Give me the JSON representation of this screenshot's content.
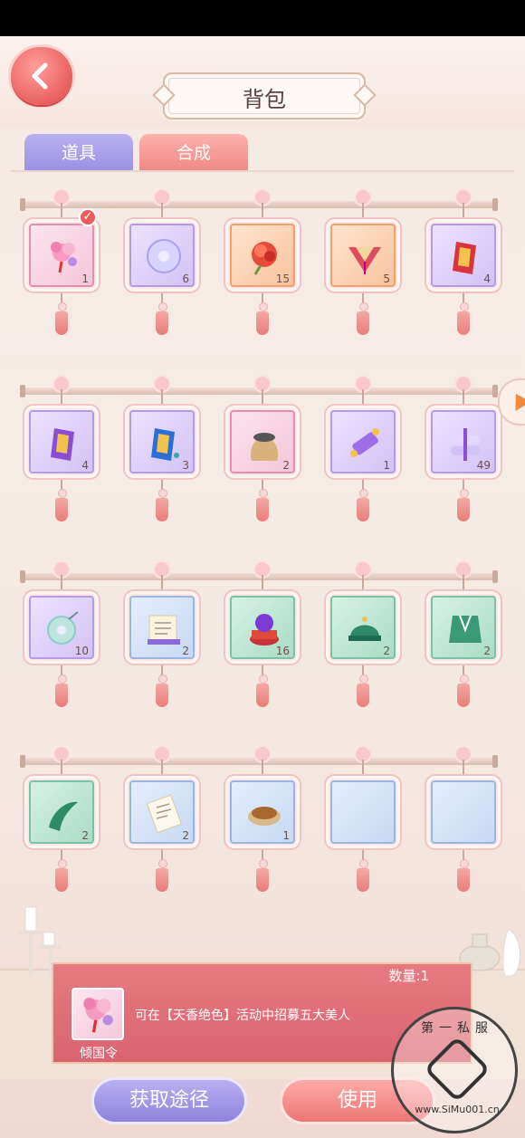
{
  "header": {
    "title": "背包"
  },
  "tabs": {
    "props": "道具",
    "craft": "合成"
  },
  "rows": [
    [
      {
        "name": "pink-flower-token",
        "bg": "pink",
        "count": "1",
        "selected": true
      },
      {
        "name": "jade-disc",
        "bg": "purple",
        "count": "6"
      },
      {
        "name": "peony-flower",
        "bg": "orange",
        "count": "15"
      },
      {
        "name": "red-fan",
        "bg": "orange",
        "count": "5"
      },
      {
        "name": "red-tablet",
        "bg": "purple",
        "count": "4"
      }
    ],
    [
      {
        "name": "purple-tablet",
        "bg": "purple",
        "count": "4"
      },
      {
        "name": "blue-tablet",
        "bg": "purple",
        "count": "3"
      },
      {
        "name": "grain-sack",
        "bg": "pink",
        "count": "2"
      },
      {
        "name": "purple-scroll",
        "bg": "purple",
        "count": "1"
      },
      {
        "name": "scroll-bundle",
        "bg": "purple",
        "count": "49"
      }
    ],
    [
      {
        "name": "jade-pendant",
        "bg": "purple",
        "count": "10"
      },
      {
        "name": "edict-scroll",
        "bg": "blue",
        "count": "2"
      },
      {
        "name": "purple-orb",
        "bg": "green",
        "count": "16"
      },
      {
        "name": "official-hat",
        "bg": "green",
        "count": "2"
      },
      {
        "name": "green-robe",
        "bg": "green",
        "count": "2"
      }
    ],
    [
      {
        "name": "green-ribbon",
        "bg": "green",
        "count": "2"
      },
      {
        "name": "letter-paper",
        "bg": "blue",
        "count": "2"
      },
      {
        "name": "bean-bowl",
        "bg": "blue",
        "count": "1"
      },
      {
        "name": "empty",
        "bg": "blue",
        "count": ""
      },
      {
        "name": "empty",
        "bg": "blue",
        "count": ""
      }
    ]
  ],
  "info": {
    "qty": "数量:1",
    "name": "倾国令",
    "desc": "可在【天香绝色】活动中招募五大美人"
  },
  "buttons": {
    "source": "获取途径",
    "use": "使用"
  },
  "watermark": {
    "top": "第一私服",
    "bottom": "www.SiMu001.cn"
  }
}
